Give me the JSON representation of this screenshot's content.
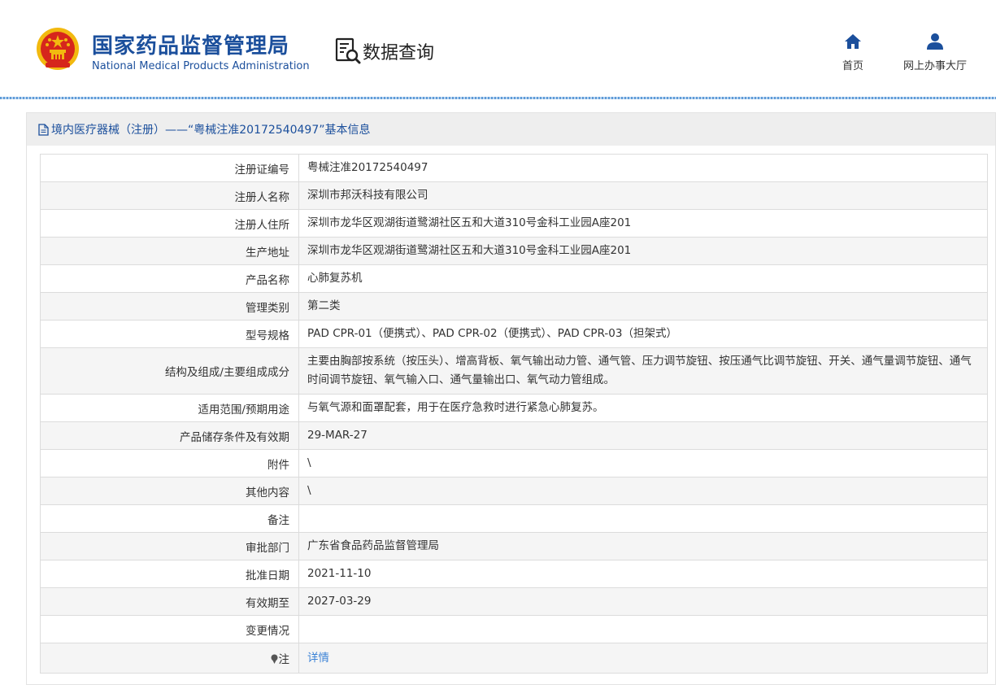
{
  "header": {
    "org_name_cn": "国家药品监督管理局",
    "org_name_en": "National Medical Products Administration",
    "query_label": "数据查询",
    "nav": {
      "home_label": "首页",
      "hall_label": "网上办事大厅"
    }
  },
  "panel": {
    "title": "境内医疗器械（注册）——“粤械注准20172540497”基本信息"
  },
  "rows": [
    {
      "label": "注册证编号",
      "value": "粤械注准20172540497"
    },
    {
      "label": "注册人名称",
      "value": "深圳市邦沃科技有限公司"
    },
    {
      "label": "注册人住所",
      "value": "深圳市龙华区观湖街道鹭湖社区五和大道310号金科工业园A座201"
    },
    {
      "label": "生产地址",
      "value": "深圳市龙华区观湖街道鹭湖社区五和大道310号金科工业园A座201"
    },
    {
      "label": "产品名称",
      "value": "心肺复苏机"
    },
    {
      "label": "管理类别",
      "value": "第二类"
    },
    {
      "label": "型号规格",
      "value": "PAD CPR-01（便携式）、PAD CPR-02（便携式）、PAD CPR-03（担架式）"
    },
    {
      "label": "结构及组成/主要组成成分",
      "value": "主要由胸部按系统（按压头）、增高背板、氧气输出动力管、通气管、压力调节旋钮、按压通气比调节旋钮、开关、通气量调节旋钮、通气时间调节旋钮、氧气输入口、通气量输出口、氧气动力管组成。"
    },
    {
      "label": "适用范围/预期用途",
      "value": "与氧气源和面罩配套，用于在医疗急救时进行紧急心肺复苏。"
    },
    {
      "label": "产品储存条件及有效期",
      "value": "29-MAR-27"
    },
    {
      "label": "附件",
      "value": "\\"
    },
    {
      "label": "其他内容",
      "value": "\\"
    },
    {
      "label": "备注",
      "value": ""
    },
    {
      "label": "审批部门",
      "value": "广东省食品药品监督管理局"
    },
    {
      "label": "批准日期",
      "value": "2021-11-10"
    },
    {
      "label": "有效期至",
      "value": "2027-03-29"
    },
    {
      "label": "变更情况",
      "value": ""
    },
    {
      "label": "注",
      "value": "详情"
    }
  ],
  "colors": {
    "brand_blue": "#1b4f9c",
    "link_blue": "#3b82d6",
    "emblem_red": "#d6261c",
    "emblem_gold": "#f2b90f"
  }
}
